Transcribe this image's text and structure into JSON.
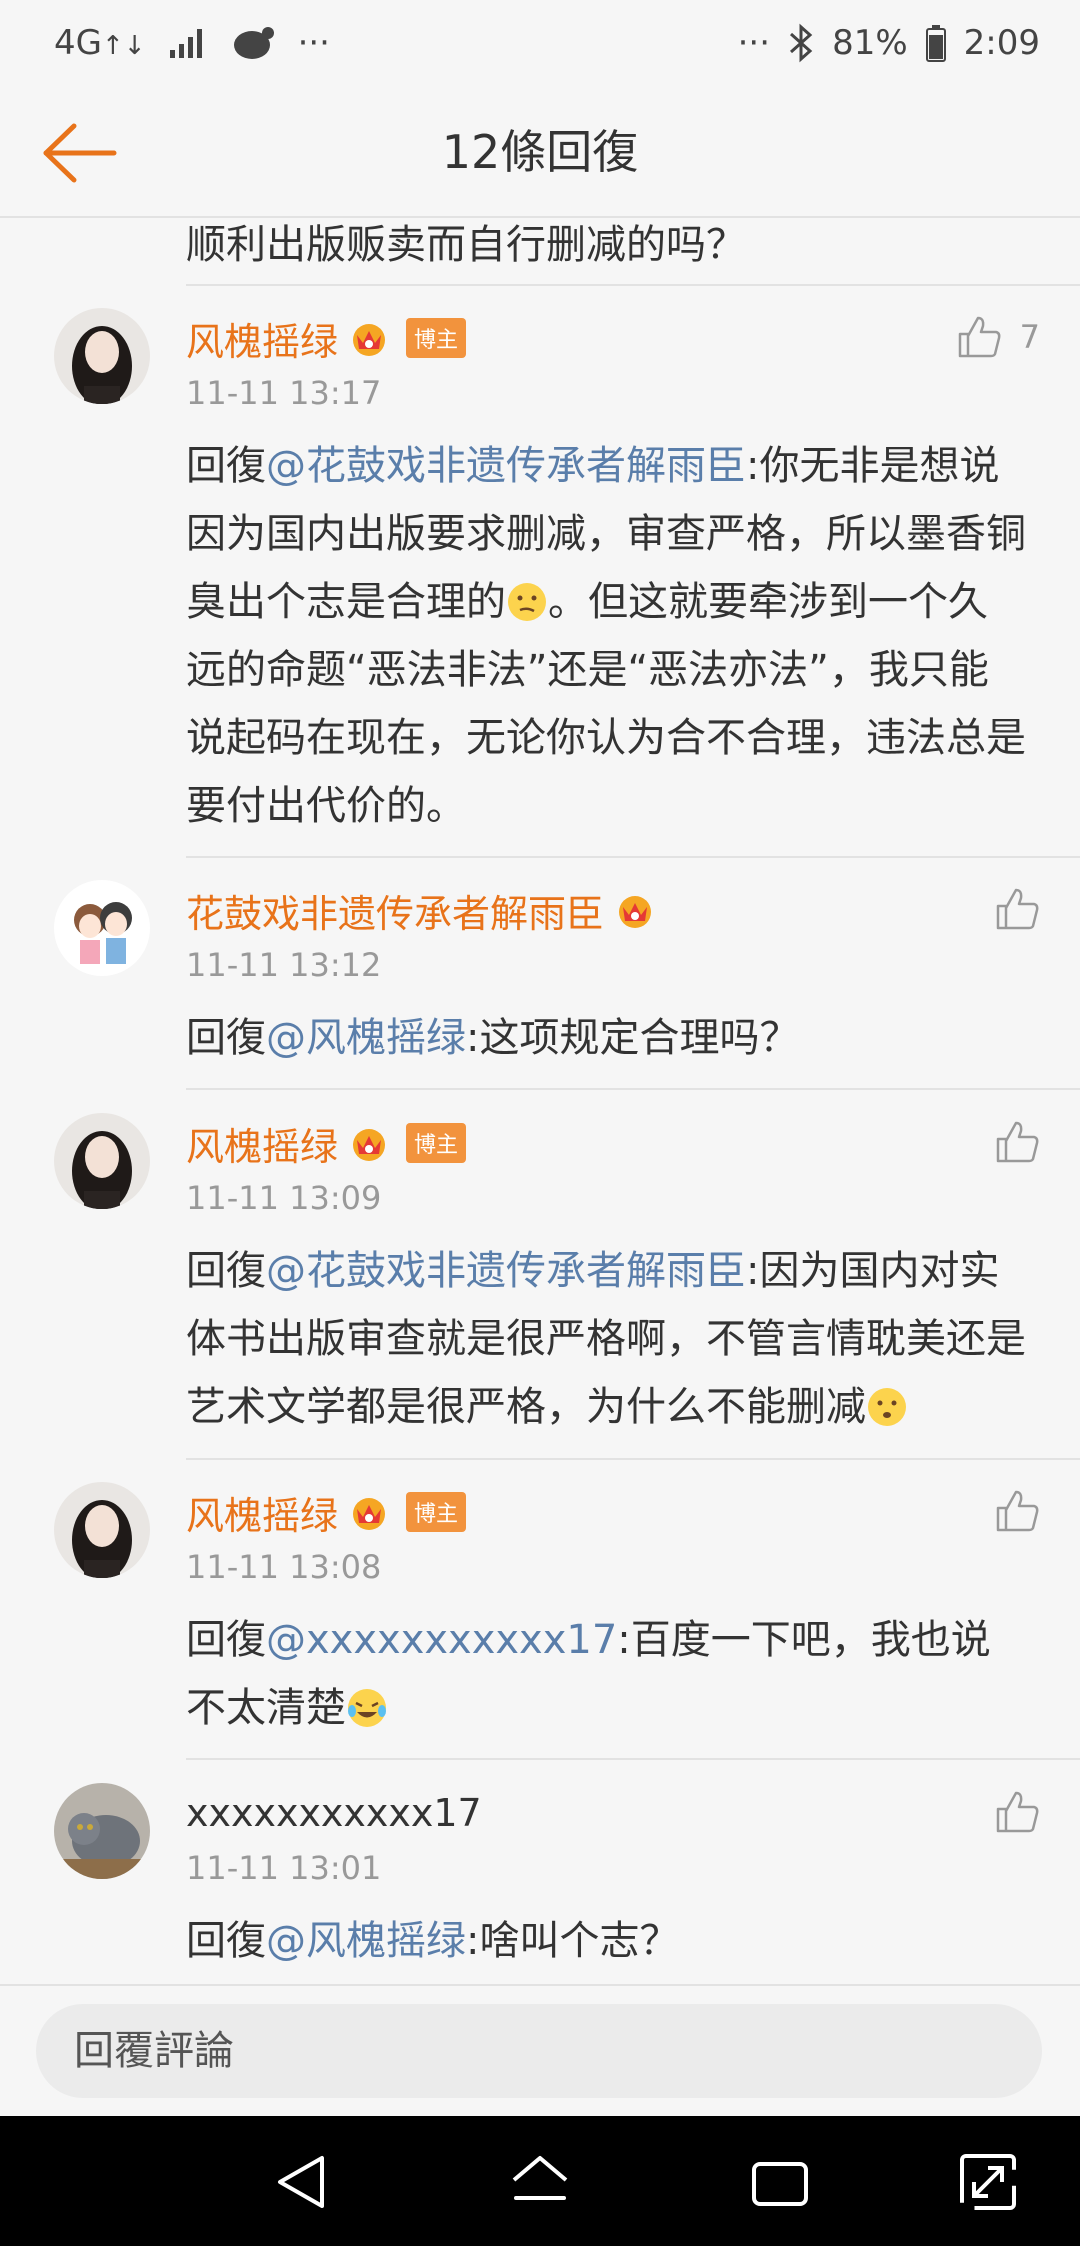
{
  "status_bar": {
    "network": "4G",
    "network_sub": "↑↓",
    "dots_left": "···",
    "dots_right": "···",
    "battery": "81%",
    "time": "2:09"
  },
  "header": {
    "title": "12條回復"
  },
  "previous_comment_tail": "顺利出版贩卖而自行删减的吗？",
  "comments": [
    {
      "name": "风槐摇绿",
      "badge": "博主",
      "time": "11-11 13:17",
      "likes": "7",
      "prefix": "回復",
      "mention": "@花鼓戏非遗传承者解雨臣",
      "text_a": ":你无非是想说因为国内出版要求删减，审查严格，所以墨香铜臭出个志是合理的",
      "text_b": "。但这就要牵涉到一个久远的命题“恶法非法”还是“恶法亦法”，我只能说起码在现在，无论你认为合不合理，违法总是要付出代价的。"
    },
    {
      "name": "花鼓戏非遗传承者解雨臣",
      "time": "11-11 13:12",
      "prefix": "回復",
      "mention": "@风槐摇绿",
      "text_a": ":这项规定合理吗？"
    },
    {
      "name": "风槐摇绿",
      "badge": "博主",
      "time": "11-11 13:09",
      "prefix": "回復",
      "mention": "@花鼓戏非遗传承者解雨臣",
      "text_a": ":因为国内对实体书出版审查就是很严格啊，不管言情耽美还是艺术文学都是很严格，为什么不能删减"
    },
    {
      "name": "风槐摇绿",
      "badge": "博主",
      "time": "11-11 13:08",
      "prefix": "回復",
      "mention": "@xxxxxxxxxxx17",
      "text_a": ":百度一下吧，我也说不太清楚"
    },
    {
      "name": "xxxxxxxxxxx17",
      "time": "11-11 13:01",
      "prefix": "回復",
      "mention": "@风槐摇绿",
      "text_a": ":啥叫个志？"
    }
  ],
  "reply_bar": {
    "placeholder": "回覆評論"
  },
  "colors": {
    "name": "#e8731a",
    "mention": "#5a7eaa",
    "badge": "#f2933d"
  }
}
